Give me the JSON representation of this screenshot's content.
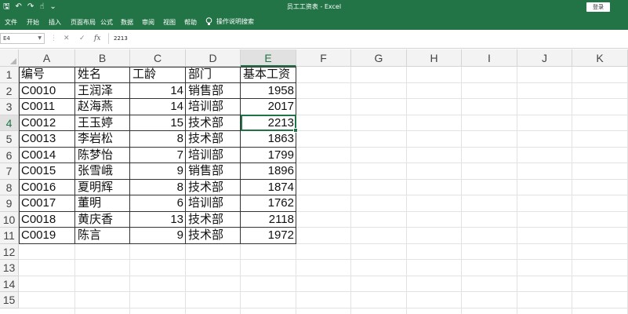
{
  "titlebar": {
    "title": "员工工资表 - Excel",
    "login": "登录",
    "qat": {
      "save": "🖫",
      "undo": "↶",
      "redo": "↷",
      "touch": "☝",
      "more": "⌄"
    }
  },
  "ribbon": {
    "tabs": [
      "文件",
      "开始",
      "插入",
      "页面布局",
      "公式",
      "数据",
      "审阅",
      "视图",
      "帮助"
    ],
    "tell_me": "操作说明搜索"
  },
  "formula_bar": {
    "name_box": "E4",
    "cancel": "✕",
    "enter": "✓",
    "fx": "fx",
    "value": "2213"
  },
  "columns": [
    "A",
    "B",
    "C",
    "D",
    "E",
    "F",
    "G",
    "H",
    "I",
    "J",
    "K"
  ],
  "rows": [
    "1",
    "2",
    "3",
    "4",
    "5",
    "6",
    "7",
    "8",
    "9",
    "10",
    "11",
    "12",
    "13",
    "14",
    "15"
  ],
  "active_cell": "E4",
  "table": {
    "headers": [
      "编号",
      "姓名",
      "工龄",
      "部门",
      "基本工资"
    ],
    "rows": [
      [
        "C0010",
        "王润泽",
        "14",
        "销售部",
        "1958"
      ],
      [
        "C0011",
        "赵海燕",
        "14",
        "培训部",
        "2017"
      ],
      [
        "C0012",
        "王玉婷",
        "15",
        "技术部",
        "2213"
      ],
      [
        "C0013",
        "李岩松",
        "8",
        "技术部",
        "1863"
      ],
      [
        "C0014",
        "陈梦怡",
        "7",
        "培训部",
        "1799"
      ],
      [
        "C0015",
        "张雪峨",
        "9",
        "销售部",
        "1896"
      ],
      [
        "C0016",
        "夏明辉",
        "8",
        "技术部",
        "1874"
      ],
      [
        "C0017",
        "董明",
        "6",
        "培训部",
        "1762"
      ],
      [
        "C0018",
        "黄庆香",
        "13",
        "技术部",
        "2118"
      ],
      [
        "C0019",
        "陈言",
        "9",
        "技术部",
        "1972"
      ]
    ]
  },
  "colors": {
    "excel_green": "#227447",
    "selection": "#217346"
  }
}
